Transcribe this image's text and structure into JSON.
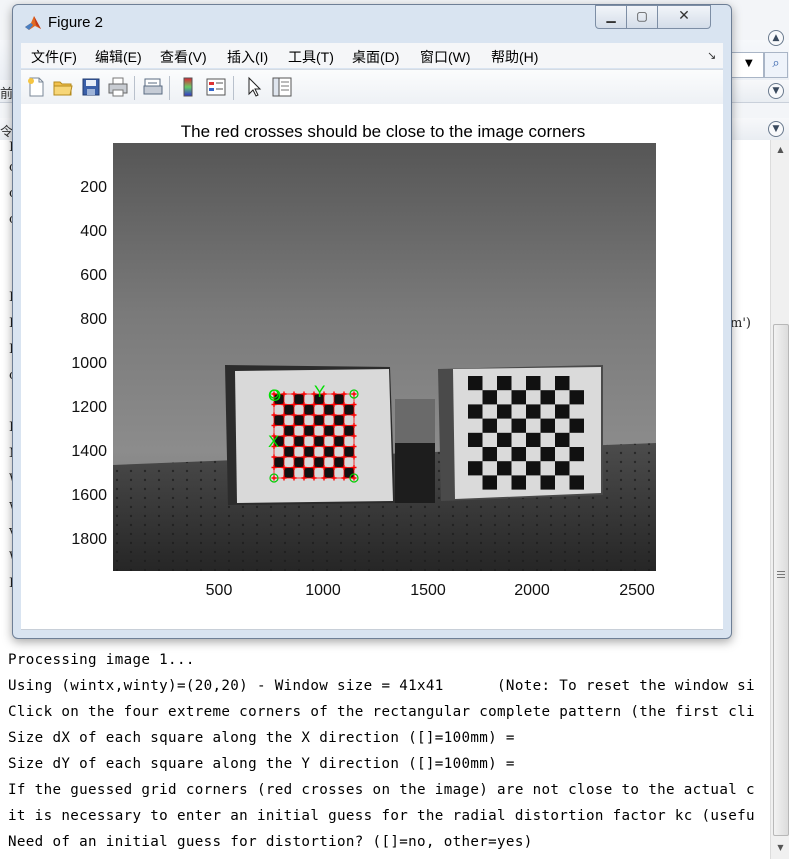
{
  "figure_window": {
    "title": "Figure 2",
    "menu": [
      "文件(F)",
      "编辑(E)",
      "查看(V)",
      "插入(I)",
      "工具(T)",
      "桌面(D)",
      "窗口(W)",
      "帮助(H)"
    ],
    "toolbar_icons": [
      "new-figure-icon",
      "open-file-icon",
      "save-icon",
      "print-icon",
      "print-preview-icon",
      "colorbar-icon",
      "legend-icon",
      "pointer-icon",
      "plot-browser-icon"
    ],
    "window_controls": [
      "minimize-icon",
      "maximize-icon",
      "close-icon"
    ]
  },
  "plot": {
    "title": "The red crosses should be close to the image corners",
    "yticks": [
      "200",
      "400",
      "600",
      "800",
      "1000",
      "1200",
      "1400",
      "1600",
      "1800"
    ],
    "xticks": [
      "500",
      "1000",
      "1500",
      "2000",
      "2500"
    ],
    "annotations": {
      "x_label": "X",
      "y_label": "Y",
      "origin_label": "O"
    },
    "colors": {
      "crosses": "#ff0000",
      "circles": "#00cc00",
      "grid_lines": "#ff0000"
    }
  },
  "background_window": {
    "row1_text": "前",
    "row2_text": "令",
    "partial_right_text": "m')",
    "left_fragments": [
      "I",
      "c",
      "c",
      "c",
      "E",
      "I",
      "I",
      "c",
      "E",
      "N",
      "W",
      "w",
      "v",
      "W",
      "I"
    ]
  },
  "command_window": {
    "lines": [
      "Processing image 1...",
      "Using (wintx,winty)=(20,20) - Window size = 41x41      (Note: To reset the window si",
      "Click on the four extreme corners of the rectangular complete pattern (the first cli",
      "Size dX of each square along the X direction ([]=100mm) = ",
      "Size dY of each square along the Y direction ([]=100mm) = ",
      "If the guessed grid corners (red crosses on the image) are not close to the actual c",
      "it is necessary to enter an initial guess for the radial distortion factor kc (usefu",
      "Need of an initial guess for distortion? ([]=no, other=yes) "
    ]
  }
}
